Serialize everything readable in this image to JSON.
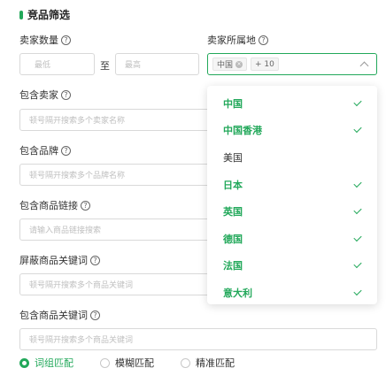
{
  "section": {
    "title": "竞品筛选"
  },
  "seller_count": {
    "label": "卖家数量",
    "min_placeholder": "最低",
    "sep": "至",
    "max_placeholder": "最高"
  },
  "seller_region": {
    "label": "卖家所属地",
    "tag": "中国",
    "more_tag": "+ 10",
    "options": [
      {
        "label": "中国",
        "selected": true
      },
      {
        "label": "中国香港",
        "selected": true
      },
      {
        "label": "美国",
        "selected": false
      },
      {
        "label": "日本",
        "selected": true
      },
      {
        "label": "英国",
        "selected": true
      },
      {
        "label": "德国",
        "selected": true
      },
      {
        "label": "法国",
        "selected": true
      },
      {
        "label": "意大利",
        "selected": true
      }
    ]
  },
  "include_seller": {
    "label": "包含卖家",
    "placeholder": "顿号隔开搜索多个卖家名称"
  },
  "include_brand": {
    "label": "包含品牌",
    "placeholder": "顿号隔开搜索多个品牌名称"
  },
  "include_link": {
    "label": "包含商品链接",
    "placeholder": "请输入商品链接搜索"
  },
  "exclude_keyword": {
    "label": "屏蔽商品关键词",
    "placeholder": "顿号隔开搜索多个商品关键词"
  },
  "include_keyword": {
    "label": "包含商品关键词",
    "placeholder": "顿号隔开搜索多个商品关键词"
  },
  "match_mode": {
    "options": [
      {
        "label": "词组匹配",
        "checked": true
      },
      {
        "label": "模糊匹配",
        "checked": false
      },
      {
        "label": "精准匹配",
        "checked": false
      }
    ]
  },
  "colors": {
    "accent": "#22a85a"
  }
}
